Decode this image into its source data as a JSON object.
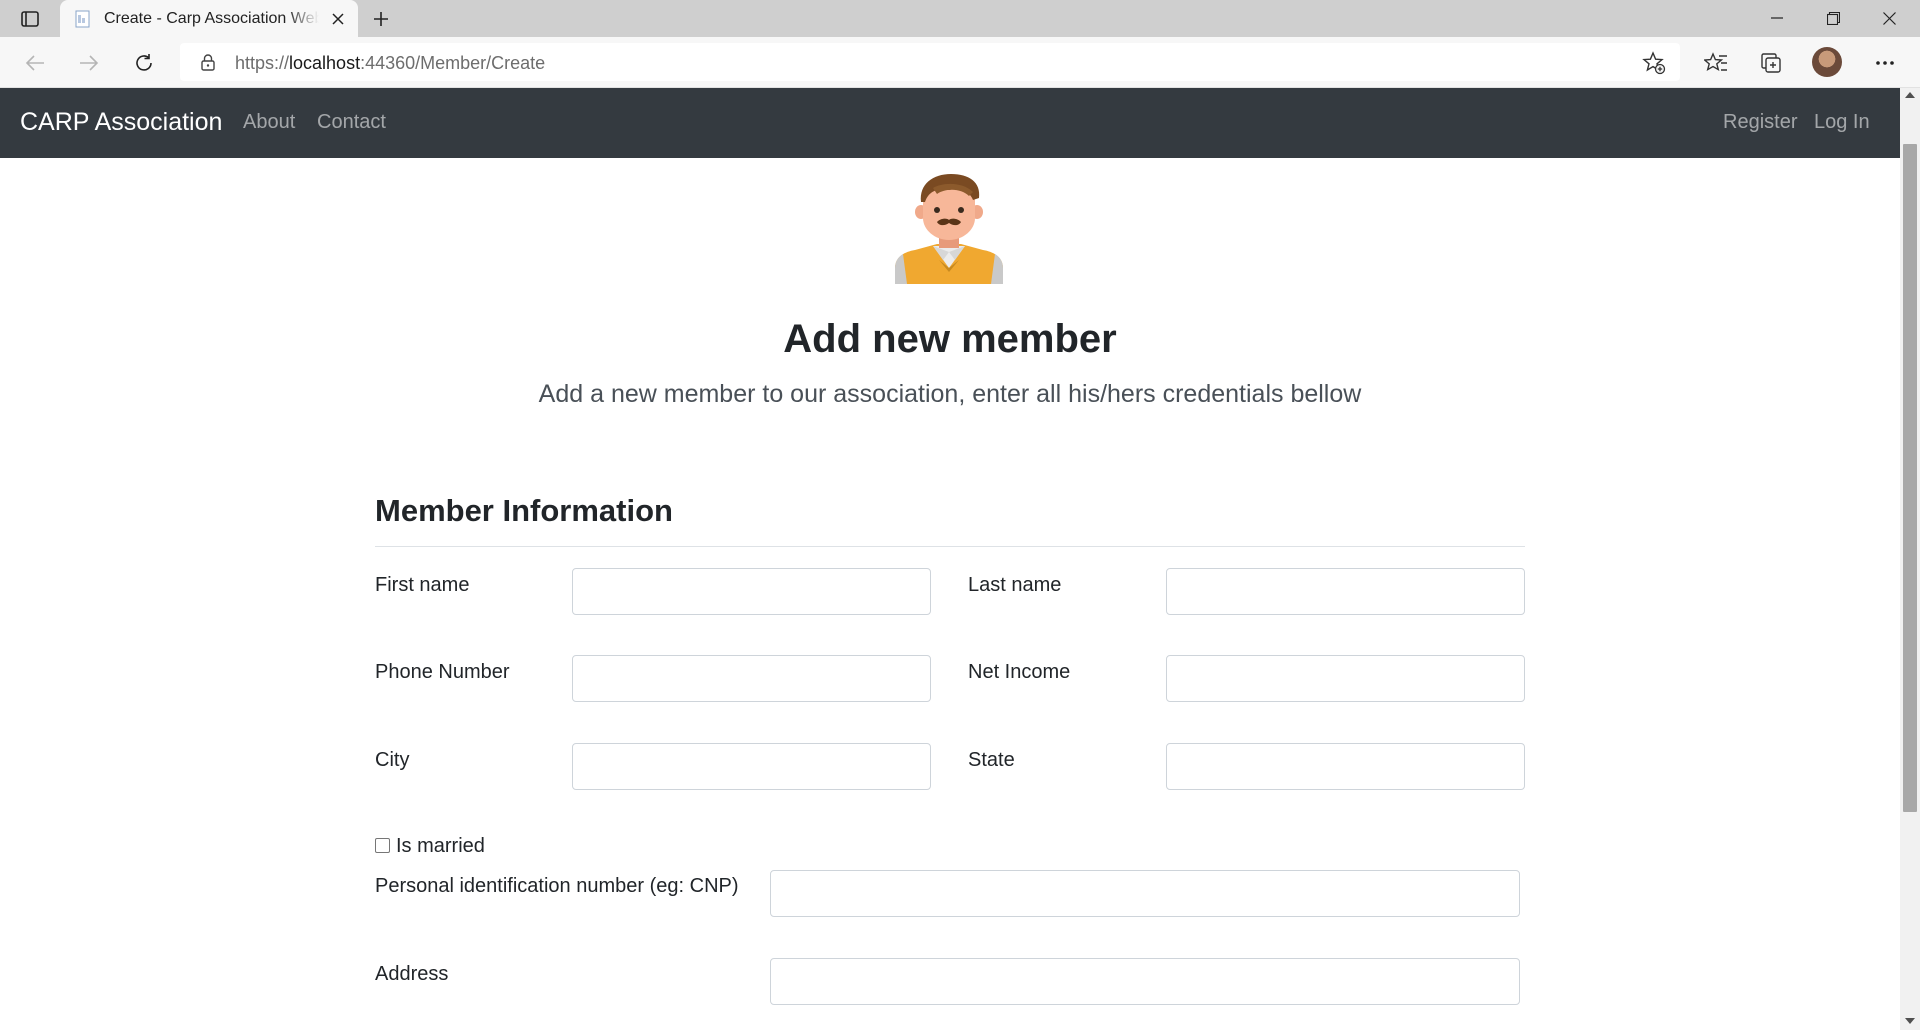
{
  "browser": {
    "tab_title": "Create - Carp Association Website",
    "url_prefix": "https://",
    "url_host": "localhost",
    "url_path": ":44360/Member/Create"
  },
  "navbar": {
    "brand": "CARP Association",
    "links": [
      "About",
      "Contact"
    ],
    "right_links": [
      "Register",
      "Log In"
    ]
  },
  "header": {
    "title": "Add new member",
    "lead": "Add a new member to our association, enter all his/hers credentials bellow"
  },
  "form": {
    "section_title": "Member Information",
    "first_name_label": "First name",
    "last_name_label": "Last name",
    "phone_label": "Phone Number",
    "net_income_label": "Net Income",
    "city_label": "City",
    "state_label": "State",
    "is_married_label": "Is married",
    "is_married_checked": false,
    "pin_label": "Personal identification number (eg: CNP)",
    "address_label": "Address",
    "values": {
      "first_name": "",
      "last_name": "",
      "phone": "",
      "net_income": "",
      "city": "",
      "state": "",
      "pin": "",
      "address": ""
    }
  },
  "icons": {
    "tab_actions": "tab-actions-icon",
    "favicon": "page-favicon-icon",
    "lock": "lock-icon",
    "avatar": "member-avatar-icon"
  },
  "colors": {
    "navbar_bg": "#343a40",
    "avatar_shirt": "#f0a830",
    "text": "#212529"
  }
}
